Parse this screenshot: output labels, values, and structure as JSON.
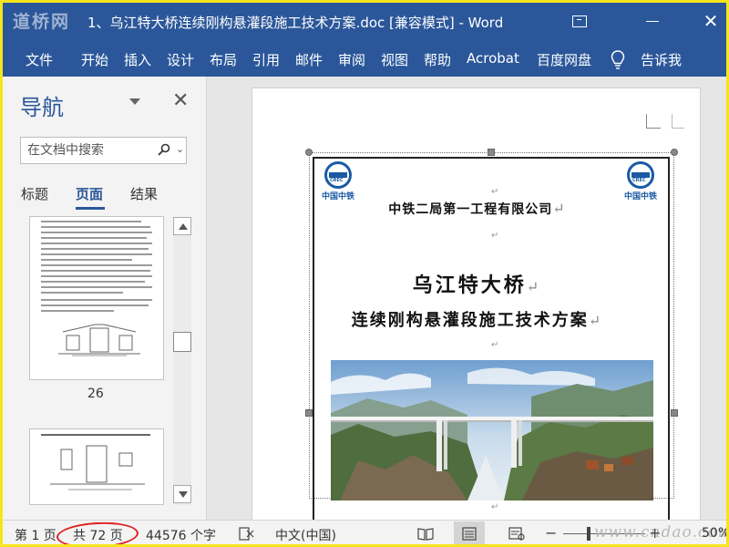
{
  "watermark": {
    "top_left": "道桥网",
    "bottom_right": "www.cndao.com"
  },
  "window": {
    "title": "1、乌江特大桥连续刚构悬灌段施工技术方案.doc [兼容模式]  -  Word"
  },
  "ribbon": {
    "tabs": [
      "文件",
      "开始",
      "插入",
      "设计",
      "布局",
      "引用",
      "邮件",
      "审阅",
      "视图",
      "帮助",
      "Acrobat",
      "百度网盘"
    ],
    "tell_me": "告诉我"
  },
  "navigation": {
    "title": "导航",
    "search_placeholder": "在文档中搜索",
    "tabs": [
      "标题",
      "页面",
      "结果"
    ],
    "active_tab": "页面",
    "thumbnail_page": "26"
  },
  "document": {
    "logo_text_left": "中国中铁",
    "logo_text_right": "中国中铁",
    "company": "中铁二局第一工程有限公司",
    "title_line1": "乌江特大桥",
    "title_line2": "连续刚构悬灌段施工技术方案",
    "paragraph_mark": "↵"
  },
  "status_bar": {
    "page": "第 1 页",
    "total_pages": "共 72 页",
    "word_count": "44576 个字",
    "language": "中文(中国)",
    "zoom": "50%"
  },
  "colors": {
    "accent": "#2b579a",
    "highlight_ring": "#e02020",
    "frame": "#f5e51b"
  }
}
